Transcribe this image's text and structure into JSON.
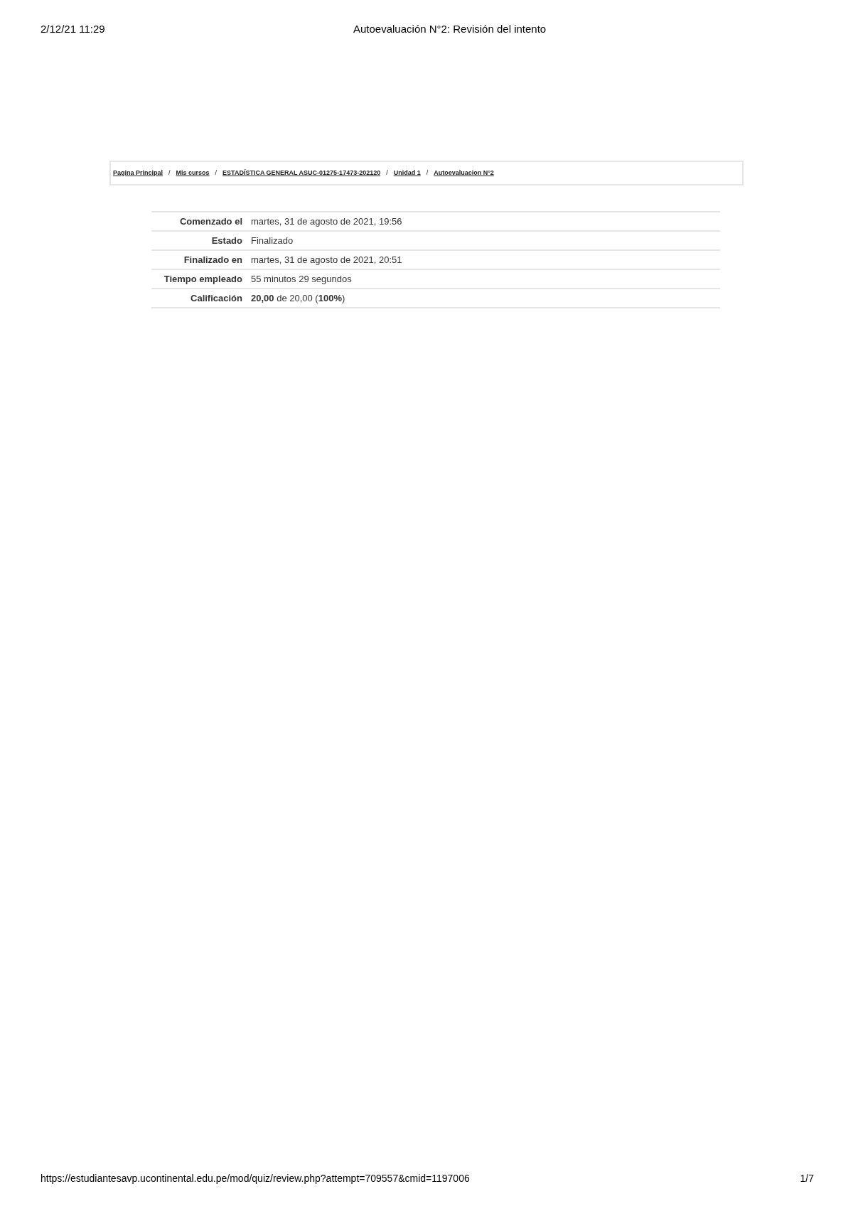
{
  "print_header": {
    "date": "2/12/21 11:29",
    "title": "Autoevaluación N°2: Revisión del intento"
  },
  "breadcrumb": {
    "separator": "/",
    "items": [
      "Pagina Principal",
      "Mis cursos",
      "ESTADÍSTICA GENERAL ASUC-01275-17473-202120",
      "Unidad 1",
      "Autoevaluacion N°2"
    ]
  },
  "summary": [
    {
      "label": "Comenzado el",
      "value": "martes, 31 de agosto de 2021, 19:56"
    },
    {
      "label": "Estado",
      "value": "Finalizado"
    },
    {
      "label": "Finalizado en",
      "value": "martes, 31 de agosto de 2021, 20:51"
    },
    {
      "label": "Tiempo empleado",
      "value": "55 minutos 29 segundos"
    },
    {
      "label": "Calificación",
      "value": "**20,00** de 20,00 (**100%**)"
    }
  ],
  "print_footer": {
    "url": "https://estudiantesavp.ucontinental.edu.pe/mod/quiz/review.php?attempt=709557&cmid=1197006",
    "page": "1/7"
  }
}
